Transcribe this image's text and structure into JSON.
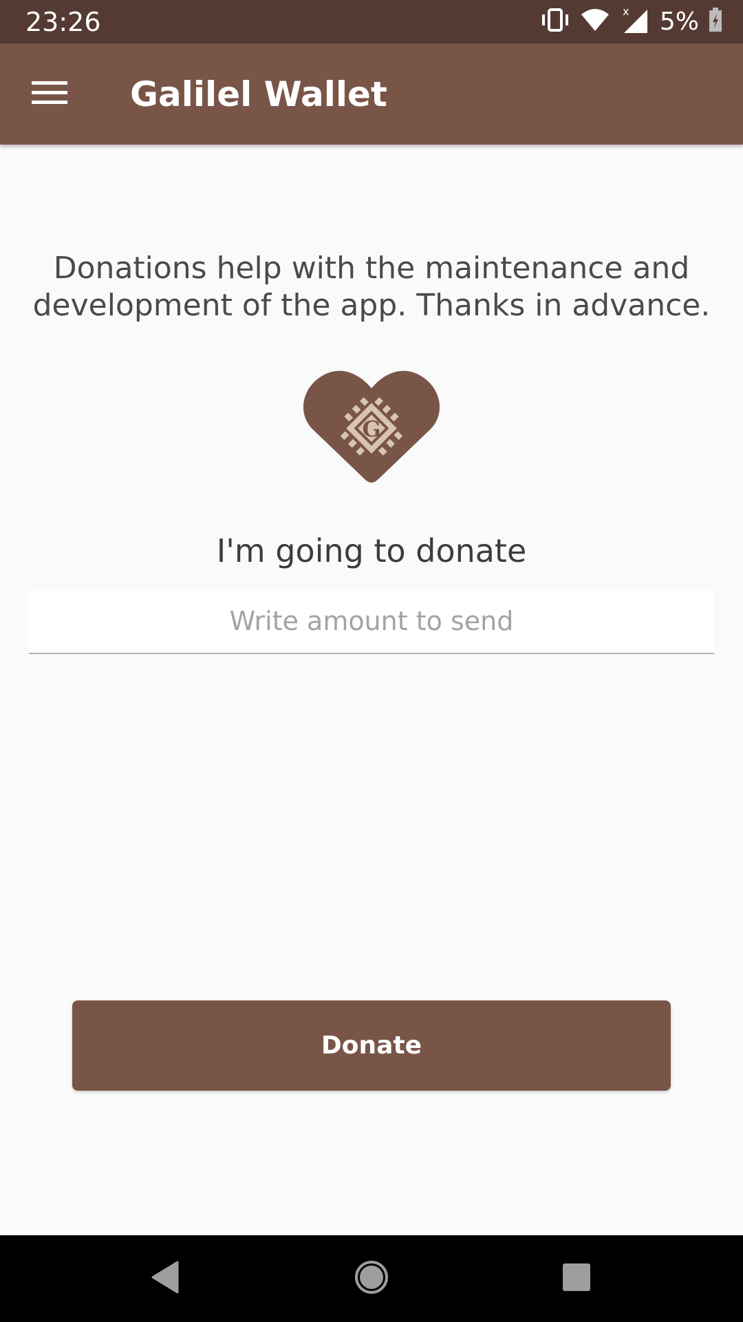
{
  "status_bar": {
    "time": "23:26",
    "battery": "5%",
    "icons": [
      "vibrate-icon",
      "wifi-icon",
      "cell-signal-icon",
      "battery-charging-icon"
    ]
  },
  "app_bar": {
    "title": "Galilel Wallet",
    "menu_icon": "hamburger-menu-icon"
  },
  "content": {
    "intro": "Donations help with the maintenance and development of the app. Thanks in advance.",
    "logo_icon": "galilel-heart-logo",
    "heading": "I'm going to donate",
    "amount_value": "",
    "amount_placeholder": "Write amount to send",
    "donate_label": "Donate"
  },
  "nav_bar": {
    "icons": [
      "back-icon",
      "home-icon",
      "recents-icon"
    ]
  },
  "colors": {
    "primary": "#795548",
    "primary_dark": "#553a33",
    "logo_accent": "#d8c5b1",
    "background": "#fafafa"
  }
}
